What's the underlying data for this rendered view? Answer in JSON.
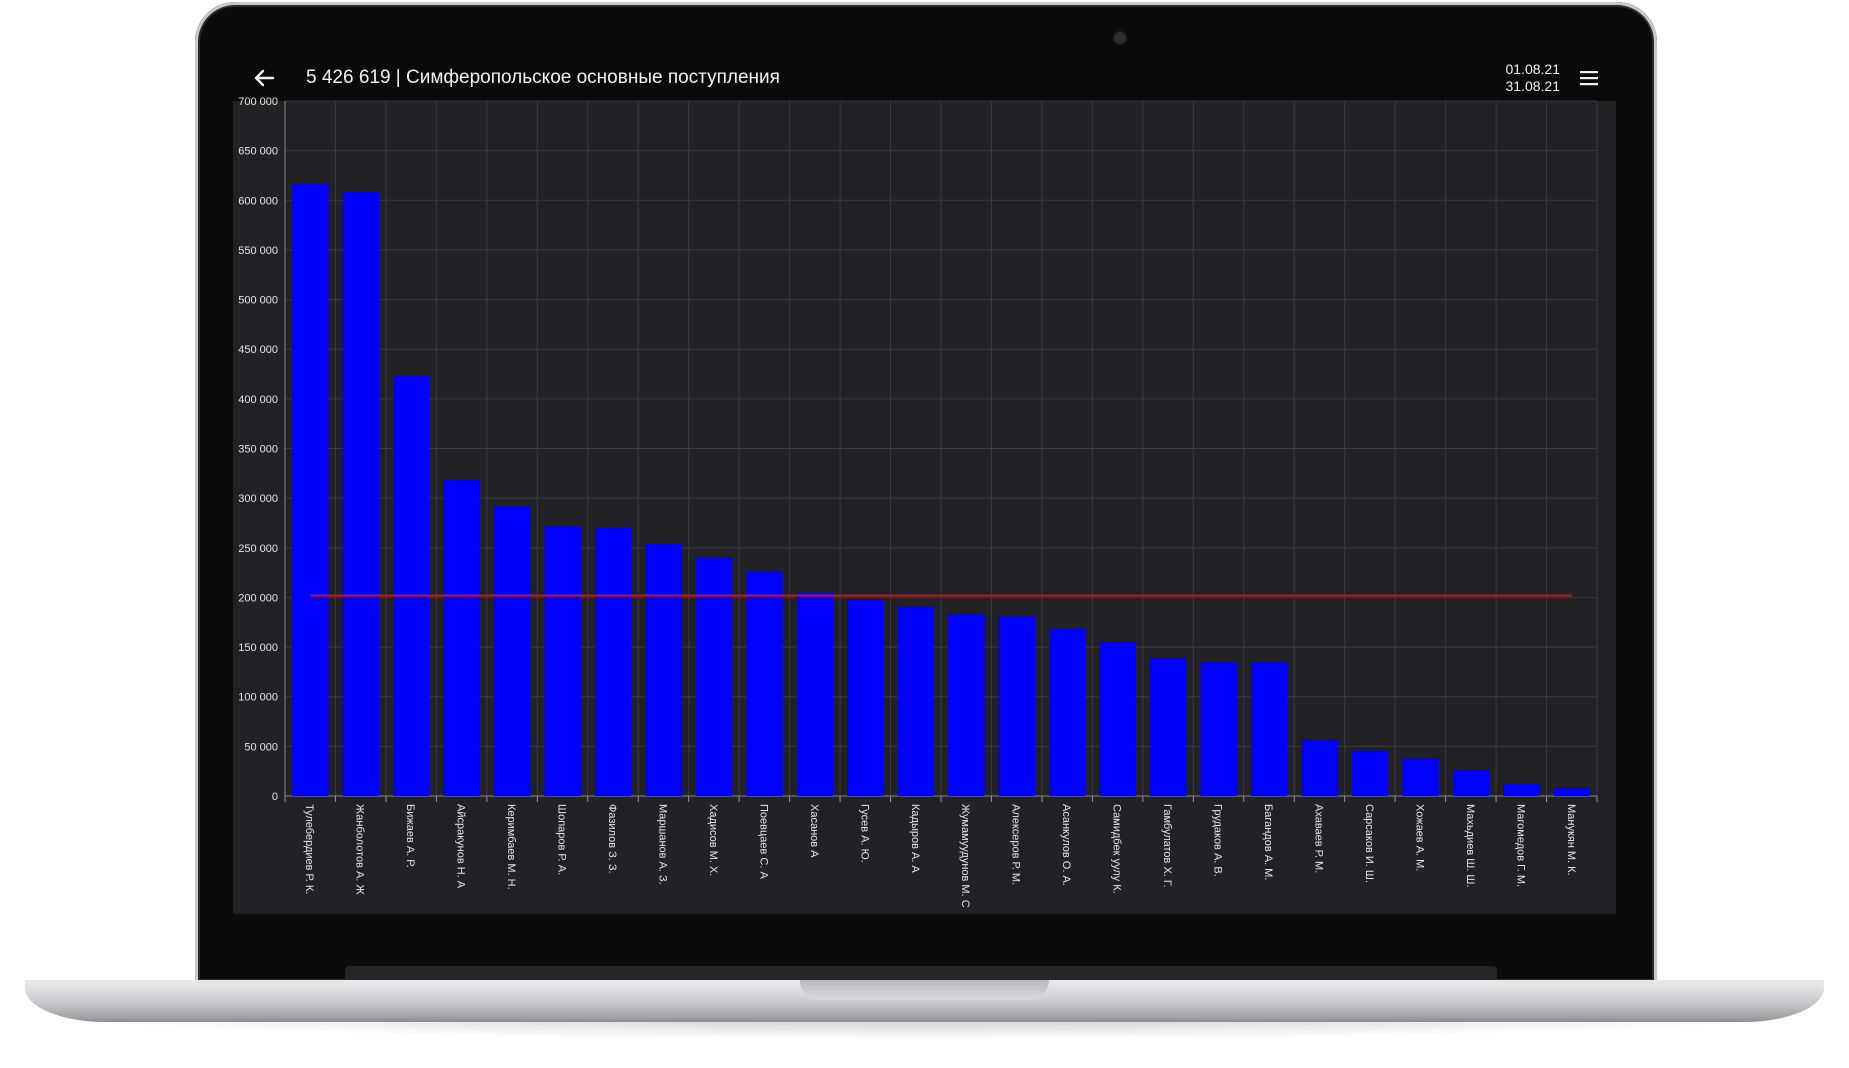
{
  "app": {
    "title": "5 426 619 | Симферопольское основные поступления",
    "date_from": "01.08.21",
    "date_to": "31.08.21",
    "back_icon": "arrow-left-icon",
    "menu_icon": "hamburger-menu-icon"
  },
  "colors": {
    "bar": "#0000ff",
    "average_line": "#c81414",
    "background": "#222226",
    "grid": "#3a3a3f",
    "text": "#e6e6e6"
  },
  "chart_data": {
    "type": "bar",
    "title": "",
    "xlabel": "",
    "ylabel": "",
    "ylim": [
      0,
      700000
    ],
    "yticks": [
      0,
      50000,
      100000,
      150000,
      200000,
      250000,
      300000,
      350000,
      400000,
      450000,
      500000,
      550000,
      600000,
      650000,
      700000
    ],
    "ytick_labels": [
      "0",
      "50 000",
      "100 000",
      "150 000",
      "200 000",
      "250 000",
      "300 000",
      "350 000",
      "400 000",
      "450 000",
      "500 000",
      "550 000",
      "600 000",
      "650 000",
      "700 000"
    ],
    "grid": true,
    "categories": [
      "Тулебердиев Р. К.",
      "Жанболотов А. Ж",
      "Бижаев А. Р.",
      "Айсракунов Н. А",
      "Керимбаев М. Н.",
      "Шопаров Р. А.",
      "Фазилов З. З.",
      "Маршанов А. З.",
      "Хадисов М. Х.",
      "Поевцаев С. А",
      "Хасанов А",
      "Гусев А. Ю.",
      "Кадыров А. А",
      "Жумамуудунов М. С",
      "Алексеров Р. М.",
      "Асанкулов О. А.",
      "Самидбек уулу К.",
      "Гамбулатов Х. Г.",
      "Грудаков А. В.",
      "Багандов А. М.",
      "Ахаваев Р. М.",
      "Сарсаков И. Ш.",
      "Хожаев А. М.",
      "Махьдиев Ш. Ш.",
      "Магомедов Г. М.",
      "Манукян М. К."
    ],
    "values": [
      617000,
      609000,
      423000,
      319000,
      292000,
      272000,
      271000,
      254000,
      241000,
      227000,
      205000,
      198000,
      191000,
      184000,
      181000,
      169000,
      156000,
      140000,
      135000,
      135000,
      57000,
      46000,
      38000,
      27000,
      13000,
      9000
    ],
    "reference_line": 202000
  }
}
